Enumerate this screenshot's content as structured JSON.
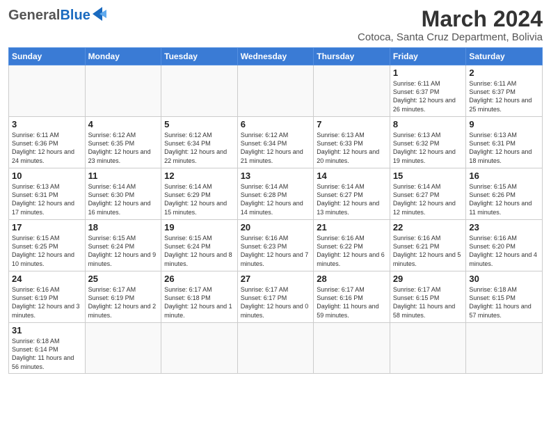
{
  "header": {
    "title": "March 2024",
    "subtitle": "Cotoca, Santa Cruz Department, Bolivia",
    "logo_general": "General",
    "logo_blue": "Blue"
  },
  "weekdays": [
    "Sunday",
    "Monday",
    "Tuesday",
    "Wednesday",
    "Thursday",
    "Friday",
    "Saturday"
  ],
  "weeks": [
    [
      {
        "day": "",
        "info": ""
      },
      {
        "day": "",
        "info": ""
      },
      {
        "day": "",
        "info": ""
      },
      {
        "day": "",
        "info": ""
      },
      {
        "day": "",
        "info": ""
      },
      {
        "day": "1",
        "info": "Sunrise: 6:11 AM\nSunset: 6:37 PM\nDaylight: 12 hours\nand 26 minutes."
      },
      {
        "day": "2",
        "info": "Sunrise: 6:11 AM\nSunset: 6:37 PM\nDaylight: 12 hours\nand 25 minutes."
      }
    ],
    [
      {
        "day": "3",
        "info": "Sunrise: 6:11 AM\nSunset: 6:36 PM\nDaylight: 12 hours\nand 24 minutes."
      },
      {
        "day": "4",
        "info": "Sunrise: 6:12 AM\nSunset: 6:35 PM\nDaylight: 12 hours\nand 23 minutes."
      },
      {
        "day": "5",
        "info": "Sunrise: 6:12 AM\nSunset: 6:34 PM\nDaylight: 12 hours\nand 22 minutes."
      },
      {
        "day": "6",
        "info": "Sunrise: 6:12 AM\nSunset: 6:34 PM\nDaylight: 12 hours\nand 21 minutes."
      },
      {
        "day": "7",
        "info": "Sunrise: 6:13 AM\nSunset: 6:33 PM\nDaylight: 12 hours\nand 20 minutes."
      },
      {
        "day": "8",
        "info": "Sunrise: 6:13 AM\nSunset: 6:32 PM\nDaylight: 12 hours\nand 19 minutes."
      },
      {
        "day": "9",
        "info": "Sunrise: 6:13 AM\nSunset: 6:31 PM\nDaylight: 12 hours\nand 18 minutes."
      }
    ],
    [
      {
        "day": "10",
        "info": "Sunrise: 6:13 AM\nSunset: 6:31 PM\nDaylight: 12 hours\nand 17 minutes."
      },
      {
        "day": "11",
        "info": "Sunrise: 6:14 AM\nSunset: 6:30 PM\nDaylight: 12 hours\nand 16 minutes."
      },
      {
        "day": "12",
        "info": "Sunrise: 6:14 AM\nSunset: 6:29 PM\nDaylight: 12 hours\nand 15 minutes."
      },
      {
        "day": "13",
        "info": "Sunrise: 6:14 AM\nSunset: 6:28 PM\nDaylight: 12 hours\nand 14 minutes."
      },
      {
        "day": "14",
        "info": "Sunrise: 6:14 AM\nSunset: 6:27 PM\nDaylight: 12 hours\nand 13 minutes."
      },
      {
        "day": "15",
        "info": "Sunrise: 6:14 AM\nSunset: 6:27 PM\nDaylight: 12 hours\nand 12 minutes."
      },
      {
        "day": "16",
        "info": "Sunrise: 6:15 AM\nSunset: 6:26 PM\nDaylight: 12 hours\nand 11 minutes."
      }
    ],
    [
      {
        "day": "17",
        "info": "Sunrise: 6:15 AM\nSunset: 6:25 PM\nDaylight: 12 hours\nand 10 minutes."
      },
      {
        "day": "18",
        "info": "Sunrise: 6:15 AM\nSunset: 6:24 PM\nDaylight: 12 hours\nand 9 minutes."
      },
      {
        "day": "19",
        "info": "Sunrise: 6:15 AM\nSunset: 6:24 PM\nDaylight: 12 hours\nand 8 minutes."
      },
      {
        "day": "20",
        "info": "Sunrise: 6:16 AM\nSunset: 6:23 PM\nDaylight: 12 hours\nand 7 minutes."
      },
      {
        "day": "21",
        "info": "Sunrise: 6:16 AM\nSunset: 6:22 PM\nDaylight: 12 hours\nand 6 minutes."
      },
      {
        "day": "22",
        "info": "Sunrise: 6:16 AM\nSunset: 6:21 PM\nDaylight: 12 hours\nand 5 minutes."
      },
      {
        "day": "23",
        "info": "Sunrise: 6:16 AM\nSunset: 6:20 PM\nDaylight: 12 hours\nand 4 minutes."
      }
    ],
    [
      {
        "day": "24",
        "info": "Sunrise: 6:16 AM\nSunset: 6:19 PM\nDaylight: 12 hours\nand 3 minutes."
      },
      {
        "day": "25",
        "info": "Sunrise: 6:17 AM\nSunset: 6:19 PM\nDaylight: 12 hours\nand 2 minutes."
      },
      {
        "day": "26",
        "info": "Sunrise: 6:17 AM\nSunset: 6:18 PM\nDaylight: 12 hours\nand 1 minute."
      },
      {
        "day": "27",
        "info": "Sunrise: 6:17 AM\nSunset: 6:17 PM\nDaylight: 12 hours\nand 0 minutes."
      },
      {
        "day": "28",
        "info": "Sunrise: 6:17 AM\nSunset: 6:16 PM\nDaylight: 11 hours\nand 59 minutes."
      },
      {
        "day": "29",
        "info": "Sunrise: 6:17 AM\nSunset: 6:15 PM\nDaylight: 11 hours\nand 58 minutes."
      },
      {
        "day": "30",
        "info": "Sunrise: 6:18 AM\nSunset: 6:15 PM\nDaylight: 11 hours\nand 57 minutes."
      }
    ],
    [
      {
        "day": "31",
        "info": "Sunrise: 6:18 AM\nSunset: 6:14 PM\nDaylight: 11 hours\nand 56 minutes."
      },
      {
        "day": "",
        "info": ""
      },
      {
        "day": "",
        "info": ""
      },
      {
        "day": "",
        "info": ""
      },
      {
        "day": "",
        "info": ""
      },
      {
        "day": "",
        "info": ""
      },
      {
        "day": "",
        "info": ""
      }
    ]
  ]
}
